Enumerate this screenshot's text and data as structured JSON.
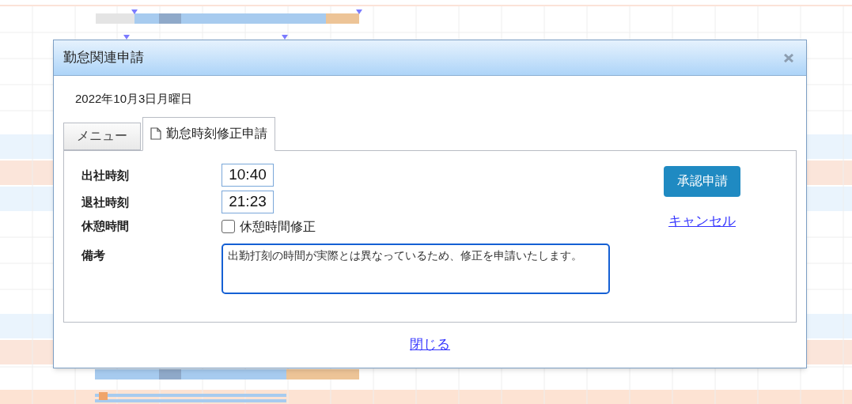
{
  "dialog": {
    "title": "勤怠関連申請",
    "date": "2022年10月3日月曜日"
  },
  "tabs": [
    {
      "kind": "plain",
      "label": "メニュー",
      "selected": false
    },
    {
      "kind": "document",
      "label": "勤怠時刻修正申請",
      "selected": true
    }
  ],
  "fields": [
    {
      "kind": "time",
      "label": "出社時刻",
      "value": "10:40"
    },
    {
      "kind": "time",
      "label": "退社時刻",
      "value": "21:23"
    },
    {
      "kind": "checkbox",
      "label": "休憩時間",
      "option": "休憩時間修正",
      "checked": false
    },
    {
      "kind": "textarea",
      "label": "備考",
      "value": "出勤打刻の時間が実際とは異なっているため、修正を申請いたします。"
    }
  ],
  "submit_button": "承認申請",
  "cancel_link": "キャンセル",
  "close_link": "閉じる"
}
